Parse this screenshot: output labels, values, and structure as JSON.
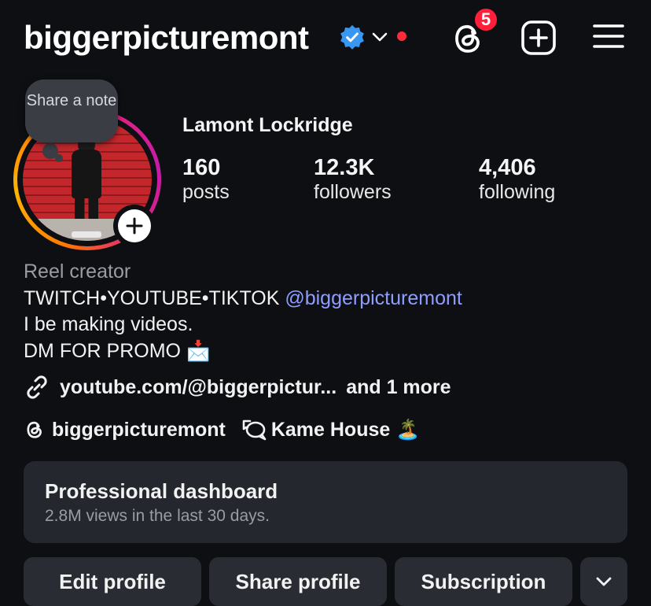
{
  "header": {
    "username": "biggerpicturemont",
    "threads_badge_count": "5"
  },
  "note": {
    "label": "Share a note"
  },
  "profile": {
    "full_name": "Lamont Lockridge",
    "stats": [
      {
        "value": "160",
        "label": "posts"
      },
      {
        "value": "12.3K",
        "label": "followers"
      },
      {
        "value": "4,406",
        "label": "following"
      }
    ]
  },
  "bio": {
    "category": "Reel creator",
    "line1_prefix": "TWITCH•YOUTUBE•TIKTOK ",
    "line1_mention": "@biggerpicturemont",
    "line2": "I be making videos.",
    "line3": "DM FOR PROMO 📩",
    "link_text": "youtube.com/@biggerpictur...",
    "link_more": "and 1 more",
    "threads_handle": "biggerpicturemont",
    "channel_name": "Kame House 🏝️"
  },
  "dashboard": {
    "title": "Professional dashboard",
    "subtitle": "2.8M views in the last 30 days."
  },
  "actions": {
    "edit_profile": "Edit profile",
    "share_profile": "Share profile",
    "subscription": "Subscription"
  },
  "colors": {
    "background": "#0d0f13",
    "mention": "#8f9dff",
    "badge": "#ff1f3b",
    "verified": "#3897f0",
    "card": "#25272e",
    "button": "#2a2c33"
  },
  "icons": {
    "verified": "verified-badge-icon",
    "account_switch": "chevron-down-icon",
    "threads": "threads-icon",
    "create": "plus-square-icon",
    "menu": "hamburger-menu-icon",
    "link": "link-icon",
    "channel": "chat-bubbles-icon",
    "more": "chevron-down-icon"
  }
}
